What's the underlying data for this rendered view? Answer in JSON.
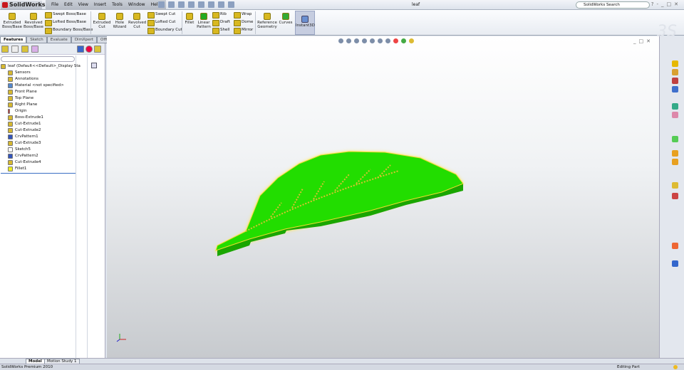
{
  "app": {
    "name": "SolidWorks",
    "document_title": "leaf",
    "search_placeholder": "SolidWorks Search"
  },
  "menu": [
    "File",
    "Edit",
    "View",
    "Insert",
    "Tools",
    "Window",
    "Help"
  ],
  "ribbon": {
    "extruded_boss": "Extruded Boss/Base",
    "revolved_boss": "Revolved Boss/Base",
    "swept_boss": "Swept Boss/Base",
    "lofted_boss": "Lofted Boss/Base",
    "boundary_boss": "Boundary Boss/Base",
    "extruded_cut": "Extruded Cut",
    "hole_wizard": "Hole Wizard",
    "revolved_cut": "Revolved Cut",
    "swept_cut": "Swept Cut",
    "lofted_cut": "Lofted Cut",
    "boundary_cut": "Boundary Cut",
    "fillet": "Fillet",
    "linear_pattern": "Linear Pattern",
    "rib": "Rib",
    "draft": "Draft",
    "shell": "Shell",
    "wrap": "Wrap",
    "dome": "Dome",
    "mirror": "Mirror",
    "reference_geometry": "Reference Geometry",
    "curves": "Curves",
    "instant3d": "Instant3D"
  },
  "tabs": [
    "Features",
    "Sketch",
    "Evaluate",
    "DimXpert",
    "Office Products"
  ],
  "tree": {
    "root": "leaf  (Default<<Default>_Display Sta",
    "items": [
      "Sensors",
      "Annotations",
      "Material <not specified>",
      "Front Plane",
      "Top Plane",
      "Right Plane",
      "Origin",
      "Boss-Extrude1",
      "Cut-Extrude1",
      "Cut-Extrude2",
      "CrvPattern1",
      "Cut-Extrude3",
      "Sketch5",
      "CrvPattern2",
      "Cut-Extrude4",
      "Fillet1"
    ]
  },
  "bottom_tabs": [
    "Model",
    "Motion Study 1"
  ],
  "status": {
    "product": "SolidWorks Premium 2010",
    "mode": "Editing Part"
  },
  "colors": {
    "model_fill": "#22dd00",
    "model_glow": "#ffe640",
    "brand": "#c8191e"
  }
}
